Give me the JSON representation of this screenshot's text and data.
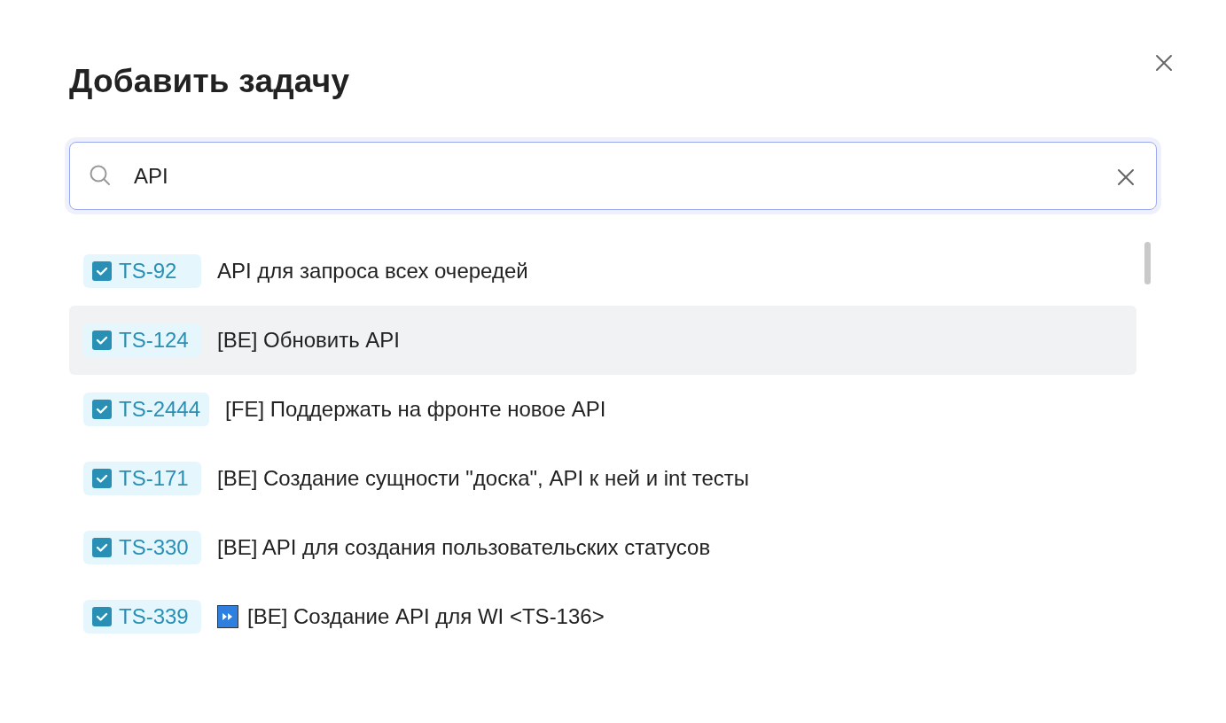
{
  "dialog": {
    "title": "Добавить задачу"
  },
  "search": {
    "value": "API"
  },
  "results": [
    {
      "key": "TS-92",
      "title": "API для запроса всех очередей",
      "checked": true,
      "selected": false,
      "kind": "plain"
    },
    {
      "key": "TS-124",
      "title": "[BE] Обновить API",
      "checked": true,
      "selected": true,
      "kind": "plain"
    },
    {
      "key": "TS-2444",
      "title": "[FE] Поддержать на фронте новое API",
      "checked": true,
      "selected": false,
      "kind": "plain"
    },
    {
      "key": "TS-171",
      "title": "[BE] Создание сущности \"доска\", API к ней и int тесты",
      "checked": true,
      "selected": false,
      "kind": "plain"
    },
    {
      "key": "TS-330",
      "title": "[BE] API для создания пользовательских статусов",
      "checked": true,
      "selected": false,
      "kind": "plain"
    },
    {
      "key": "TS-339",
      "title": "[BE] Создание API для WI <TS-136>",
      "checked": true,
      "selected": false,
      "kind": "fast-forward"
    }
  ]
}
